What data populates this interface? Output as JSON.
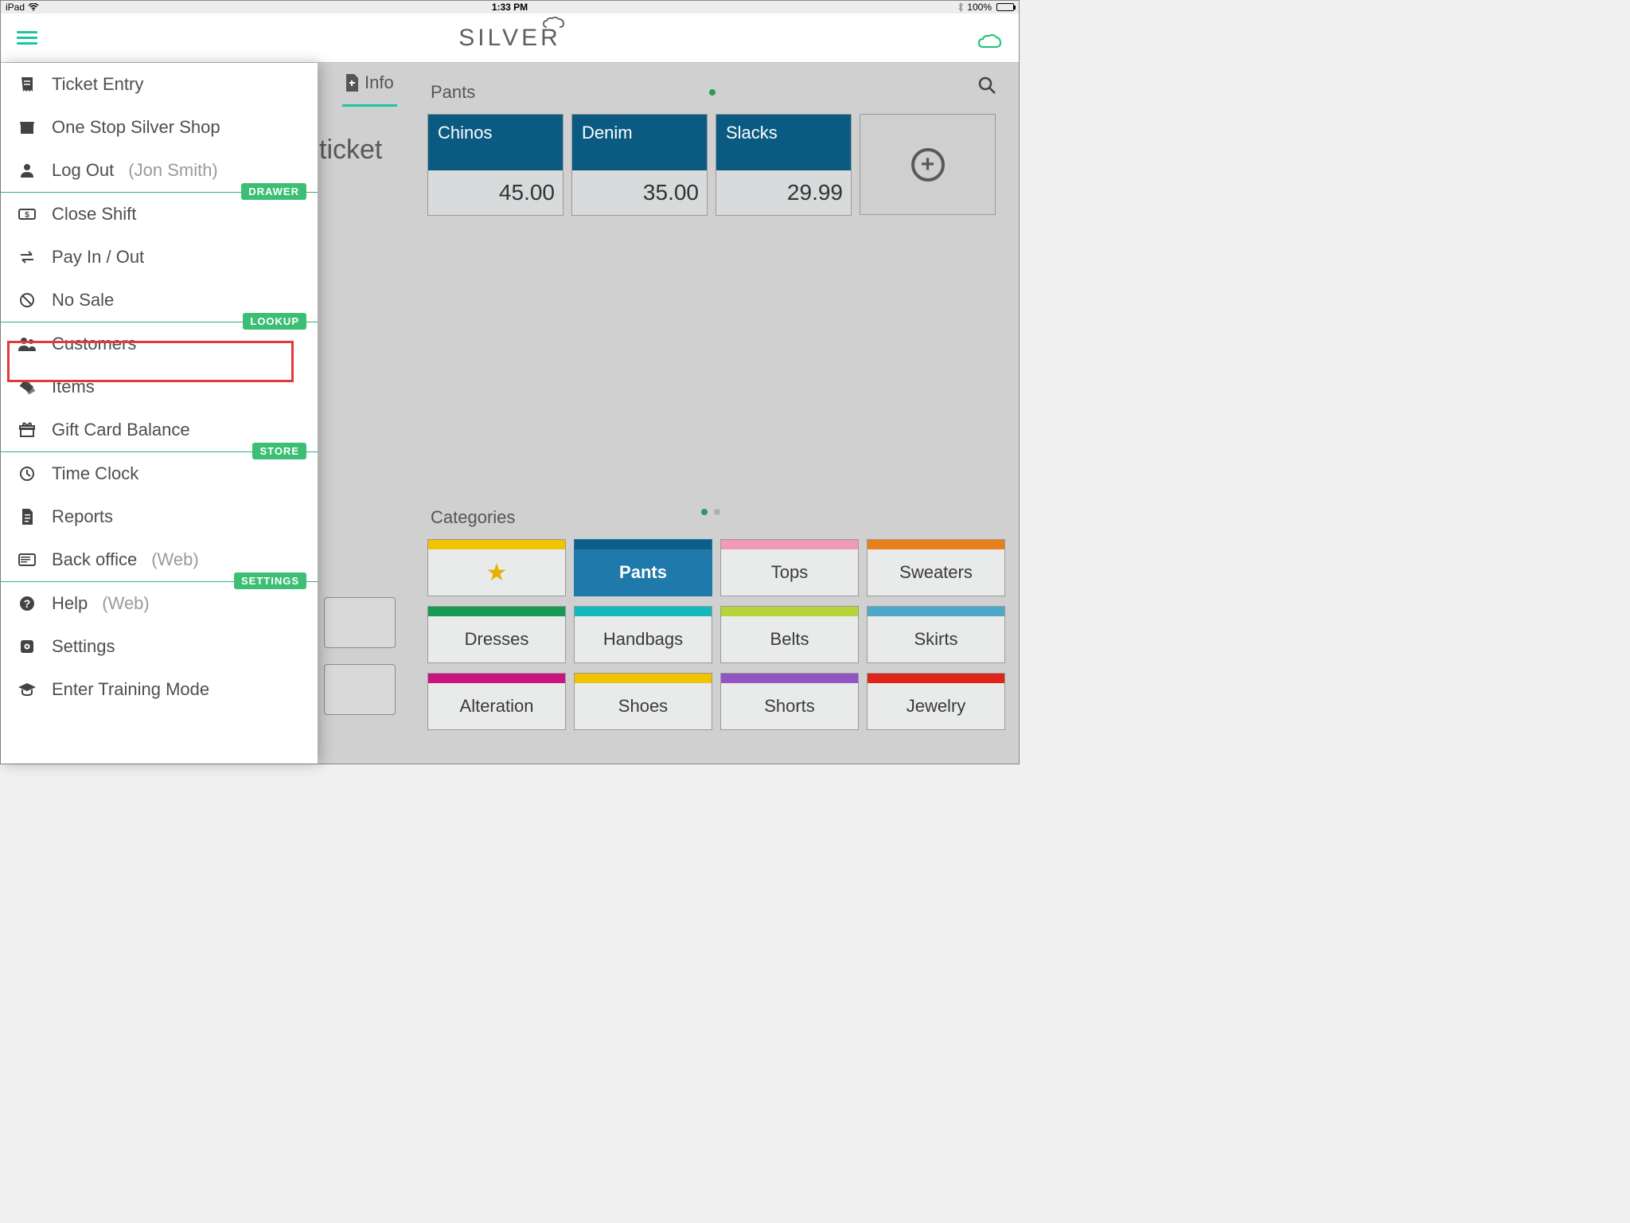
{
  "status": {
    "device": "iPad",
    "time": "1:33 PM",
    "battery": "100%"
  },
  "logo": "SILVER",
  "main": {
    "info_tab": "Info",
    "ticket_title": "ticket",
    "items_header": "Pants",
    "categories_header": "Categories",
    "items": [
      {
        "name": "Chinos",
        "price": "45.00"
      },
      {
        "name": "Denim",
        "price": "35.00"
      },
      {
        "name": "Slacks",
        "price": "29.99"
      }
    ],
    "categories": [
      {
        "label": "",
        "stripe": "#efc400",
        "star": true,
        "selected": false
      },
      {
        "label": "Pants",
        "stripe": "#0d5f88",
        "selected": true
      },
      {
        "label": "Tops",
        "stripe": "#ef9bb3",
        "selected": false
      },
      {
        "label": "Sweaters",
        "stripe": "#e77f1e",
        "selected": false
      },
      {
        "label": "Dresses",
        "stripe": "#169a56",
        "selected": false
      },
      {
        "label": "Handbags",
        "stripe": "#12b8bd",
        "selected": false
      },
      {
        "label": "Belts",
        "stripe": "#b6d437",
        "selected": false
      },
      {
        "label": "Skirts",
        "stripe": "#4da8c9",
        "selected": false
      },
      {
        "label": "Alteration",
        "stripe": "#c9167f",
        "selected": false
      },
      {
        "label": "Shoes",
        "stripe": "#f2c400",
        "selected": false
      },
      {
        "label": "Shorts",
        "stripe": "#9156c3",
        "selected": false
      },
      {
        "label": "Jewelry",
        "stripe": "#e02318",
        "selected": false
      }
    ]
  },
  "menu": {
    "sections": [
      {
        "badge": null,
        "items": [
          {
            "icon": "receipt",
            "label": "Ticket Entry",
            "suffix": ""
          },
          {
            "icon": "store",
            "label": "One Stop Silver Shop",
            "suffix": ""
          },
          {
            "icon": "person",
            "label": "Log Out",
            "suffix": "(Jon Smith)"
          }
        ]
      },
      {
        "badge": "DRAWER",
        "items": [
          {
            "icon": "cash",
            "label": "Close Shift",
            "suffix": ""
          },
          {
            "icon": "swap",
            "label": "Pay In / Out",
            "suffix": ""
          },
          {
            "icon": "nosale",
            "label": "No Sale",
            "suffix": ""
          }
        ]
      },
      {
        "badge": "LOOKUP",
        "items": [
          {
            "icon": "people",
            "label": "Customers",
            "suffix": ""
          },
          {
            "icon": "tags",
            "label": "Items",
            "suffix": ""
          },
          {
            "icon": "gift",
            "label": "Gift Card Balance",
            "suffix": ""
          }
        ]
      },
      {
        "badge": "STORE",
        "items": [
          {
            "icon": "clock",
            "label": "Time Clock",
            "suffix": ""
          },
          {
            "icon": "doc",
            "label": "Reports",
            "suffix": ""
          },
          {
            "icon": "web",
            "label": "Back office",
            "suffix": "(Web)"
          }
        ]
      },
      {
        "badge": "SETTINGS",
        "items": [
          {
            "icon": "help",
            "label": "Help",
            "suffix": "(Web)"
          },
          {
            "icon": "gear",
            "label": "Settings",
            "suffix": ""
          },
          {
            "icon": "grad",
            "label": "Enter Training Mode",
            "suffix": ""
          }
        ]
      }
    ]
  }
}
